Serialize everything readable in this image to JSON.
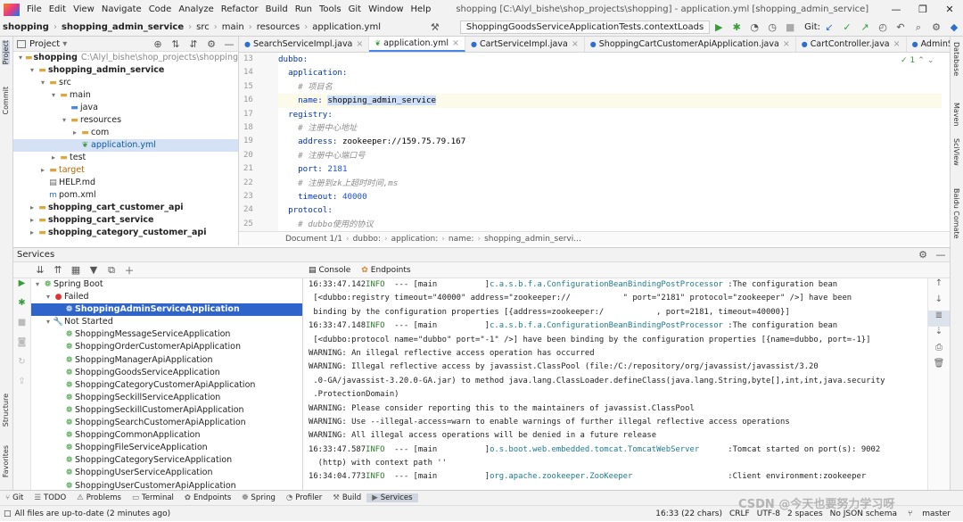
{
  "menu": {
    "items": [
      "File",
      "Edit",
      "View",
      "Navigate",
      "Code",
      "Analyze",
      "Refactor",
      "Build",
      "Run",
      "Tools",
      "Git",
      "Window",
      "Help"
    ],
    "window_title": "shopping [C:\\Alyl_bishe\\shop_projects\\shopping] - application.yml [shopping_admin_service]"
  },
  "nav": {
    "crumbs": [
      "shopping",
      "shopping_admin_service",
      "src",
      "main",
      "resources",
      "application.yml"
    ],
    "run_config": "ShoppingGoodsServiceApplicationTests.contextLoads",
    "git_label": "Git:"
  },
  "left_strip": {
    "project": "Project",
    "commit": "Commit",
    "structure": "Structure",
    "favorites": "Favorites"
  },
  "right_strip": {
    "database": "Database",
    "maven": "Maven",
    "sciview": "SciView",
    "baidu": "Baidu Comate"
  },
  "project": {
    "header": "Project",
    "tree": [
      {
        "label": "shopping",
        "extra": "C:\\Alyl_bishe\\shop_projects\\shopping",
        "depth": 0,
        "arrow": "▾",
        "icon": "folder",
        "bold": true
      },
      {
        "label": "shopping_admin_service",
        "extra": "",
        "depth": 1,
        "arrow": "▾",
        "icon": "folder",
        "bold": true
      },
      {
        "label": "src",
        "extra": "",
        "depth": 2,
        "arrow": "▾",
        "icon": "folder",
        "bold": false
      },
      {
        "label": "main",
        "extra": "",
        "depth": 3,
        "arrow": "▾",
        "icon": "folder",
        "bold": false
      },
      {
        "label": "java",
        "extra": "",
        "depth": 4,
        "arrow": "",
        "icon": "folder-blue",
        "bold": false
      },
      {
        "label": "resources",
        "extra": "",
        "depth": 4,
        "arrow": "▾",
        "icon": "folder",
        "bold": false
      },
      {
        "label": "com",
        "extra": "",
        "depth": 5,
        "arrow": "▸",
        "icon": "folder",
        "bold": false
      },
      {
        "label": "application.yml",
        "extra": "",
        "depth": 5,
        "arrow": "",
        "icon": "yml",
        "bold": false,
        "selected": true
      },
      {
        "label": "test",
        "extra": "",
        "depth": 3,
        "arrow": "▸",
        "icon": "folder",
        "bold": false
      },
      {
        "label": "target",
        "extra": "",
        "depth": 2,
        "arrow": "▸",
        "icon": "folder-orange",
        "bold": false
      },
      {
        "label": "HELP.md",
        "extra": "",
        "depth": 2,
        "arrow": "",
        "icon": "md",
        "bold": false
      },
      {
        "label": "pom.xml",
        "extra": "",
        "depth": 2,
        "arrow": "",
        "icon": "m",
        "bold": false
      },
      {
        "label": "shopping_cart_customer_api",
        "extra": "",
        "depth": 1,
        "arrow": "▸",
        "icon": "folder",
        "bold": true
      },
      {
        "label": "shopping_cart_service",
        "extra": "",
        "depth": 1,
        "arrow": "▸",
        "icon": "folder",
        "bold": true
      },
      {
        "label": "shopping_category_customer_api",
        "extra": "",
        "depth": 1,
        "arrow": "▸",
        "icon": "folder",
        "bold": true
      }
    ]
  },
  "editor": {
    "tabs": [
      {
        "label": "SearchServiceImpl.java",
        "active": false
      },
      {
        "label": "application.yml",
        "active": true
      },
      {
        "label": "CartServiceImpl.java",
        "active": false
      },
      {
        "label": "ShoppingCartCustomerApiApplication.java",
        "active": false
      },
      {
        "label": "CartController.java",
        "active": false
      },
      {
        "label": "AdminServiceImpl.java",
        "active": false
      }
    ],
    "line_numbers": [
      "13",
      "14",
      "15",
      "16",
      "17",
      "18",
      "19",
      "20",
      "21",
      "22",
      "23",
      "24",
      "25"
    ],
    "check_count": "1",
    "breadcrumb": [
      "Document 1/1",
      "dubbo:",
      "application:",
      "name:",
      "shopping_admin_servi..."
    ]
  },
  "services": {
    "header": "Services",
    "tree": [
      {
        "label": "Spring Boot",
        "depth": 0,
        "arrow": "▾",
        "icon": "spring"
      },
      {
        "label": "Failed",
        "depth": 1,
        "arrow": "▾",
        "icon": "failed"
      },
      {
        "label": "ShoppingAdminServiceApplication",
        "depth": 2,
        "arrow": "",
        "icon": "app-err",
        "selected": true
      },
      {
        "label": "Not Started",
        "depth": 1,
        "arrow": "▾",
        "icon": "wrench"
      },
      {
        "label": "ShoppingMessageServiceApplication",
        "depth": 2,
        "arrow": "",
        "icon": "app"
      },
      {
        "label": "ShoppingOrderCustomerApiApplication",
        "depth": 2,
        "arrow": "",
        "icon": "app"
      },
      {
        "label": "ShoppingManagerApiApplication",
        "depth": 2,
        "arrow": "",
        "icon": "app"
      },
      {
        "label": "ShoppingGoodsServiceApplication",
        "depth": 2,
        "arrow": "",
        "icon": "app"
      },
      {
        "label": "ShoppingCategoryCustomerApiApplication",
        "depth": 2,
        "arrow": "",
        "icon": "app"
      },
      {
        "label": "ShoppingSeckillServiceApplication",
        "depth": 2,
        "arrow": "",
        "icon": "app"
      },
      {
        "label": "ShoppingSeckillCustomerApiApplication",
        "depth": 2,
        "arrow": "",
        "icon": "app"
      },
      {
        "label": "ShoppingSearchCustomerApiApplication",
        "depth": 2,
        "arrow": "",
        "icon": "app"
      },
      {
        "label": "ShoppingCommonApplication",
        "depth": 2,
        "arrow": "",
        "icon": "app"
      },
      {
        "label": "ShoppingFileServiceApplication",
        "depth": 2,
        "arrow": "",
        "icon": "app"
      },
      {
        "label": "ShoppingCategoryServiceApplication",
        "depth": 2,
        "arrow": "",
        "icon": "app"
      },
      {
        "label": "ShoppingUserServiceApplication",
        "depth": 2,
        "arrow": "",
        "icon": "app"
      },
      {
        "label": "ShoppingUserCustomerApiApplication",
        "depth": 2,
        "arrow": "",
        "icon": "app"
      }
    ],
    "console_tabs": [
      "Console",
      "Endpoints"
    ]
  },
  "bottom_tabs": [
    "Git",
    "TODO",
    "Problems",
    "Terminal",
    "Endpoints",
    "Spring",
    "Profiler",
    "Build",
    "Services"
  ],
  "bottom_active": "Services",
  "status": {
    "message": "All files are up-to-date (2 minutes ago)",
    "position": "16:33 (22 chars)",
    "line_sep": "CRLF",
    "encoding": "UTF-8",
    "indent": "2 spaces",
    "schema": "No JSON schema",
    "branch": "master"
  },
  "watermark": "CSDN @今天也要努力学习呀"
}
